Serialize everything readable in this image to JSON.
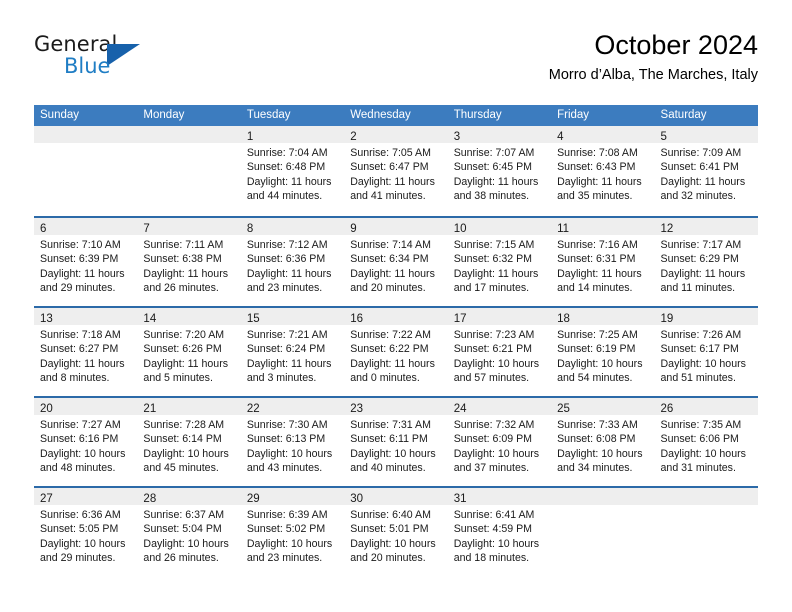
{
  "brand": {
    "word_one": "General",
    "word_two": "Blue",
    "triangle_color": "#1761ab",
    "blue_color": "#1f7dc4"
  },
  "header": {
    "title": "October 2024",
    "location": "Morro d’Alba, The Marches, Italy"
  },
  "calendar": {
    "accent_color": "#3c7cbf",
    "row_rule_color": "#2c6aa8",
    "daynum_band_color": "#eeeeee",
    "weekday_headers": [
      "Sunday",
      "Monday",
      "Tuesday",
      "Wednesday",
      "Thursday",
      "Friday",
      "Saturday"
    ],
    "weeks": [
      [
        {
          "day": "",
          "lines": []
        },
        {
          "day": "",
          "lines": []
        },
        {
          "day": "1",
          "lines": [
            "Sunrise: 7:04 AM",
            "Sunset: 6:48 PM",
            "Daylight: 11 hours",
            "and 44 minutes."
          ]
        },
        {
          "day": "2",
          "lines": [
            "Sunrise: 7:05 AM",
            "Sunset: 6:47 PM",
            "Daylight: 11 hours",
            "and 41 minutes."
          ]
        },
        {
          "day": "3",
          "lines": [
            "Sunrise: 7:07 AM",
            "Sunset: 6:45 PM",
            "Daylight: 11 hours",
            "and 38 minutes."
          ]
        },
        {
          "day": "4",
          "lines": [
            "Sunrise: 7:08 AM",
            "Sunset: 6:43 PM",
            "Daylight: 11 hours",
            "and 35 minutes."
          ]
        },
        {
          "day": "5",
          "lines": [
            "Sunrise: 7:09 AM",
            "Sunset: 6:41 PM",
            "Daylight: 11 hours",
            "and 32 minutes."
          ]
        }
      ],
      [
        {
          "day": "6",
          "lines": [
            "Sunrise: 7:10 AM",
            "Sunset: 6:39 PM",
            "Daylight: 11 hours",
            "and 29 minutes."
          ]
        },
        {
          "day": "7",
          "lines": [
            "Sunrise: 7:11 AM",
            "Sunset: 6:38 PM",
            "Daylight: 11 hours",
            "and 26 minutes."
          ]
        },
        {
          "day": "8",
          "lines": [
            "Sunrise: 7:12 AM",
            "Sunset: 6:36 PM",
            "Daylight: 11 hours",
            "and 23 minutes."
          ]
        },
        {
          "day": "9",
          "lines": [
            "Sunrise: 7:14 AM",
            "Sunset: 6:34 PM",
            "Daylight: 11 hours",
            "and 20 minutes."
          ]
        },
        {
          "day": "10",
          "lines": [
            "Sunrise: 7:15 AM",
            "Sunset: 6:32 PM",
            "Daylight: 11 hours",
            "and 17 minutes."
          ]
        },
        {
          "day": "11",
          "lines": [
            "Sunrise: 7:16 AM",
            "Sunset: 6:31 PM",
            "Daylight: 11 hours",
            "and 14 minutes."
          ]
        },
        {
          "day": "12",
          "lines": [
            "Sunrise: 7:17 AM",
            "Sunset: 6:29 PM",
            "Daylight: 11 hours",
            "and 11 minutes."
          ]
        }
      ],
      [
        {
          "day": "13",
          "lines": [
            "Sunrise: 7:18 AM",
            "Sunset: 6:27 PM",
            "Daylight: 11 hours",
            "and 8 minutes."
          ]
        },
        {
          "day": "14",
          "lines": [
            "Sunrise: 7:20 AM",
            "Sunset: 6:26 PM",
            "Daylight: 11 hours",
            "and 5 minutes."
          ]
        },
        {
          "day": "15",
          "lines": [
            "Sunrise: 7:21 AM",
            "Sunset: 6:24 PM",
            "Daylight: 11 hours",
            "and 3 minutes."
          ]
        },
        {
          "day": "16",
          "lines": [
            "Sunrise: 7:22 AM",
            "Sunset: 6:22 PM",
            "Daylight: 11 hours",
            "and 0 minutes."
          ]
        },
        {
          "day": "17",
          "lines": [
            "Sunrise: 7:23 AM",
            "Sunset: 6:21 PM",
            "Daylight: 10 hours",
            "and 57 minutes."
          ]
        },
        {
          "day": "18",
          "lines": [
            "Sunrise: 7:25 AM",
            "Sunset: 6:19 PM",
            "Daylight: 10 hours",
            "and 54 minutes."
          ]
        },
        {
          "day": "19",
          "lines": [
            "Sunrise: 7:26 AM",
            "Sunset: 6:17 PM",
            "Daylight: 10 hours",
            "and 51 minutes."
          ]
        }
      ],
      [
        {
          "day": "20",
          "lines": [
            "Sunrise: 7:27 AM",
            "Sunset: 6:16 PM",
            "Daylight: 10 hours",
            "and 48 minutes."
          ]
        },
        {
          "day": "21",
          "lines": [
            "Sunrise: 7:28 AM",
            "Sunset: 6:14 PM",
            "Daylight: 10 hours",
            "and 45 minutes."
          ]
        },
        {
          "day": "22",
          "lines": [
            "Sunrise: 7:30 AM",
            "Sunset: 6:13 PM",
            "Daylight: 10 hours",
            "and 43 minutes."
          ]
        },
        {
          "day": "23",
          "lines": [
            "Sunrise: 7:31 AM",
            "Sunset: 6:11 PM",
            "Daylight: 10 hours",
            "and 40 minutes."
          ]
        },
        {
          "day": "24",
          "lines": [
            "Sunrise: 7:32 AM",
            "Sunset: 6:09 PM",
            "Daylight: 10 hours",
            "and 37 minutes."
          ]
        },
        {
          "day": "25",
          "lines": [
            "Sunrise: 7:33 AM",
            "Sunset: 6:08 PM",
            "Daylight: 10 hours",
            "and 34 minutes."
          ]
        },
        {
          "day": "26",
          "lines": [
            "Sunrise: 7:35 AM",
            "Sunset: 6:06 PM",
            "Daylight: 10 hours",
            "and 31 minutes."
          ]
        }
      ],
      [
        {
          "day": "27",
          "lines": [
            "Sunrise: 6:36 AM",
            "Sunset: 5:05 PM",
            "Daylight: 10 hours",
            "and 29 minutes."
          ]
        },
        {
          "day": "28",
          "lines": [
            "Sunrise: 6:37 AM",
            "Sunset: 5:04 PM",
            "Daylight: 10 hours",
            "and 26 minutes."
          ]
        },
        {
          "day": "29",
          "lines": [
            "Sunrise: 6:39 AM",
            "Sunset: 5:02 PM",
            "Daylight: 10 hours",
            "and 23 minutes."
          ]
        },
        {
          "day": "30",
          "lines": [
            "Sunrise: 6:40 AM",
            "Sunset: 5:01 PM",
            "Daylight: 10 hours",
            "and 20 minutes."
          ]
        },
        {
          "day": "31",
          "lines": [
            "Sunrise: 6:41 AM",
            "Sunset: 4:59 PM",
            "Daylight: 10 hours",
            "and 18 minutes."
          ]
        },
        {
          "day": "",
          "lines": []
        },
        {
          "day": "",
          "lines": []
        }
      ]
    ]
  }
}
